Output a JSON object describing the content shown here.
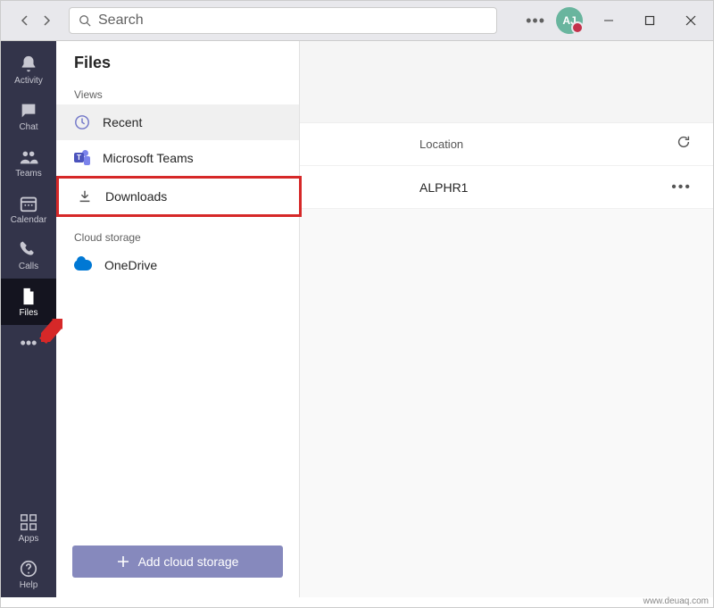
{
  "titlebar": {
    "search_placeholder": "Search",
    "avatar_initials": "AJ"
  },
  "rail": {
    "activity": "Activity",
    "chat": "Chat",
    "teams": "Teams",
    "calendar": "Calendar",
    "calls": "Calls",
    "files": "Files",
    "apps": "Apps",
    "help": "Help"
  },
  "files": {
    "title": "Files",
    "views_label": "Views",
    "recent": "Recent",
    "teams": "Microsoft Teams",
    "downloads": "Downloads",
    "cloud_label": "Cloud storage",
    "onedrive": "OneDrive",
    "add_cloud": "Add cloud storage"
  },
  "detail": {
    "location_header": "Location",
    "row1_name": "ALPHR1"
  },
  "watermark": "www.deuaq.com"
}
